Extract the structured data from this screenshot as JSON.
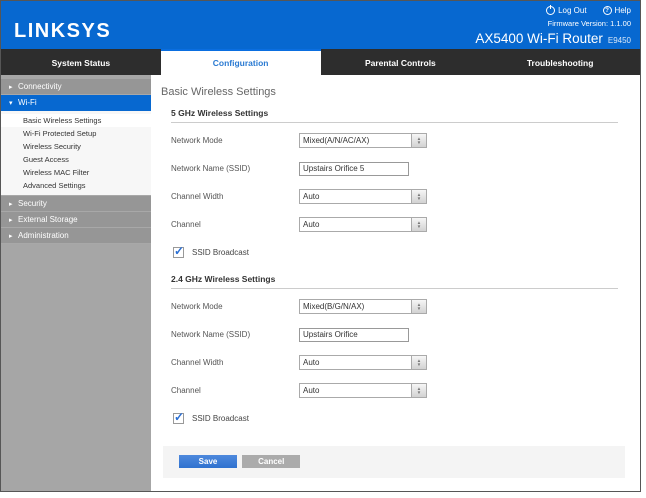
{
  "colors": {
    "brand_blue": "#0768d0",
    "tab_bar": "#2d2d2d",
    "sidebar_gray": "#a6a6a6",
    "save_button": "#3a7cd8",
    "cancel_button": "#ababab"
  },
  "header": {
    "logo": "LINKSYS",
    "logout_label": "Log Out",
    "help_label": "Help",
    "firmware": "Firmware Version: 1.1.00",
    "router_name": "AX5400 Wi-Fi Router",
    "router_model": "E9450"
  },
  "tabs": [
    {
      "label": "System Status",
      "active": false
    },
    {
      "label": "Configuration",
      "active": true
    },
    {
      "label": "Parental Controls",
      "active": false
    },
    {
      "label": "Troubleshooting",
      "active": false
    }
  ],
  "sidebar": {
    "items": [
      {
        "label": "Connectivity",
        "caret": "▸",
        "expanded": false
      },
      {
        "label": "Wi-Fi",
        "caret": "▾",
        "expanded": true
      },
      {
        "label": "Security",
        "caret": "▸",
        "expanded": false
      },
      {
        "label": "External Storage",
        "caret": "▸",
        "expanded": false
      },
      {
        "label": "Administration",
        "caret": "▸",
        "expanded": false
      }
    ],
    "wifi_subitems": [
      {
        "label": "Basic Wireless Settings",
        "active": true
      },
      {
        "label": "Wi-Fi Protected Setup",
        "active": false
      },
      {
        "label": "Wireless Security",
        "active": false
      },
      {
        "label": "Guest Access",
        "active": false
      },
      {
        "label": "Wireless MAC Filter",
        "active": false
      },
      {
        "label": "Advanced Settings",
        "active": false
      }
    ]
  },
  "main": {
    "title": "Basic Wireless Settings",
    "sections": [
      {
        "heading": "5 GHz Wireless Settings",
        "fields": [
          {
            "label": "Network Mode",
            "type": "select",
            "value": "Mixed(A/N/AC/AX)"
          },
          {
            "label": "Network Name (SSID)",
            "type": "text",
            "value": "Upstairs Orifice 5"
          },
          {
            "label": "Channel Width",
            "type": "select",
            "value": "Auto"
          },
          {
            "label": "Channel",
            "type": "select",
            "value": "Auto"
          },
          {
            "label": "SSID Broadcast",
            "type": "checkbox",
            "checked": true,
            "check_glyph": "✓"
          }
        ]
      },
      {
        "heading": "2.4 GHz Wireless Settings",
        "fields": [
          {
            "label": "Network Mode",
            "type": "select",
            "value": "Mixed(B/G/N/AX)"
          },
          {
            "label": "Network Name (SSID)",
            "type": "text",
            "value": "Upstairs Orifice"
          },
          {
            "label": "Channel Width",
            "type": "select",
            "value": "Auto"
          },
          {
            "label": "Channel",
            "type": "select",
            "value": "Auto"
          },
          {
            "label": "SSID Broadcast",
            "type": "checkbox",
            "checked": true,
            "check_glyph": "✓"
          }
        ]
      }
    ],
    "save_label": "Save",
    "cancel_label": "Cancel"
  }
}
